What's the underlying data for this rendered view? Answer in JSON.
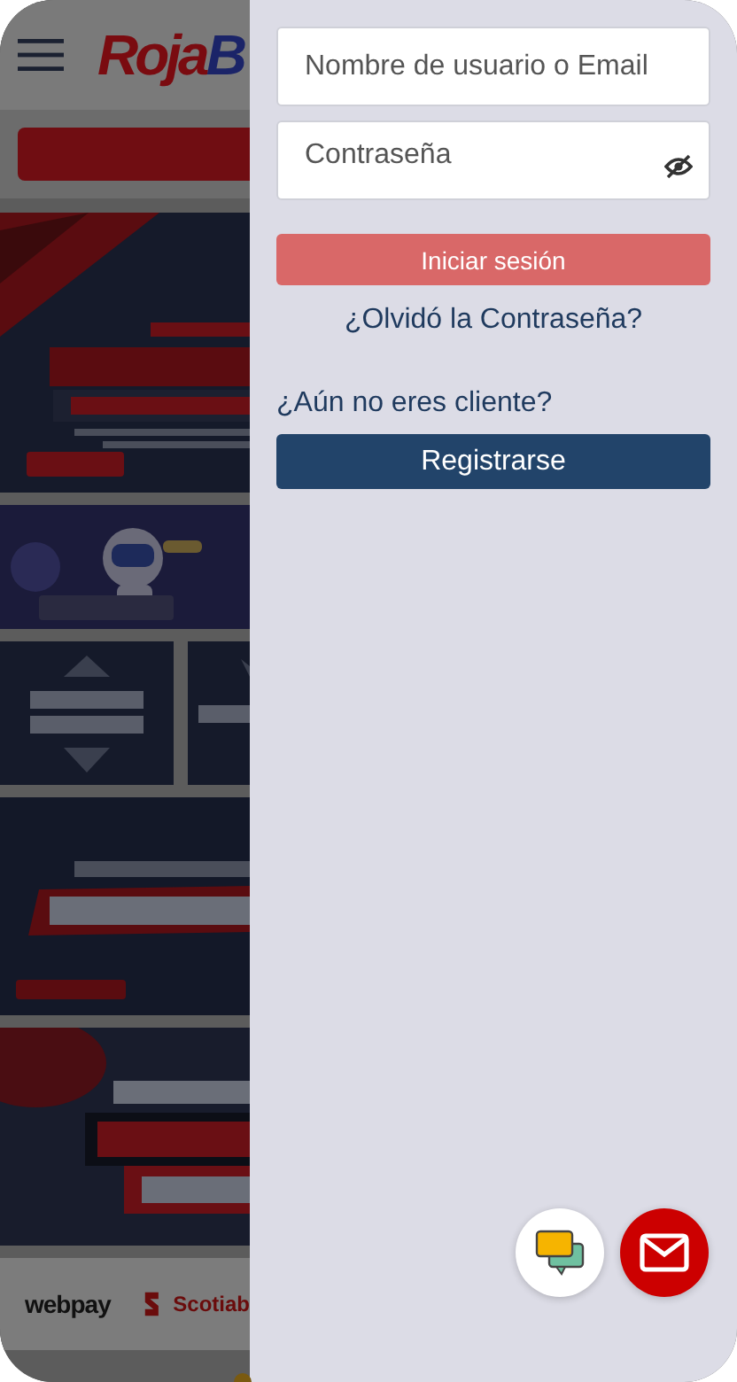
{
  "header": {
    "logo": {
      "first": "Roja",
      "second": "B"
    }
  },
  "login": {
    "username": {
      "placeholder": "Nombre de usuario o Email"
    },
    "password": {
      "placeholder": "Contraseña",
      "show_password": false
    },
    "submit": {
      "label": "Iniciar sesión",
      "disabled": true
    },
    "forgot": "¿Olvidó la Contraseña?",
    "register_prompt": "¿Aún no eres cliente?",
    "register": "Registrarse"
  },
  "footer": {
    "payment_logos": [
      "webpay",
      "Scotiab"
    ]
  }
}
